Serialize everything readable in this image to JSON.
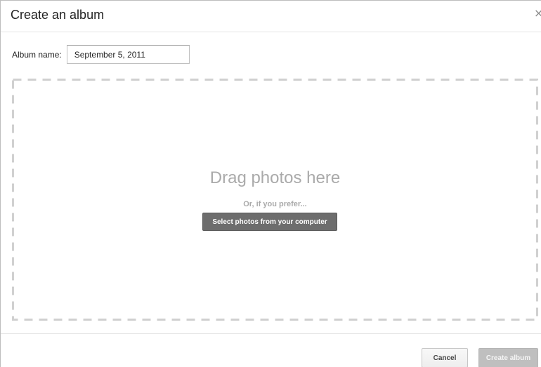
{
  "dialog": {
    "title": "Create an album",
    "close_glyph": "×"
  },
  "album_name": {
    "label": "Album name:",
    "value": "September 5, 2011"
  },
  "drop_zone": {
    "title": "Drag photos here",
    "subtitle": "Or, if you prefer...",
    "select_button": "Select photos from your computer"
  },
  "footer": {
    "cancel_label": "Cancel",
    "create_label": "Create album"
  },
  "colors": {
    "dashed_border": "#d0d0d0",
    "select_button_bg": "#6d6d6d",
    "create_button_disabled_bg": "#bfbfbf"
  }
}
